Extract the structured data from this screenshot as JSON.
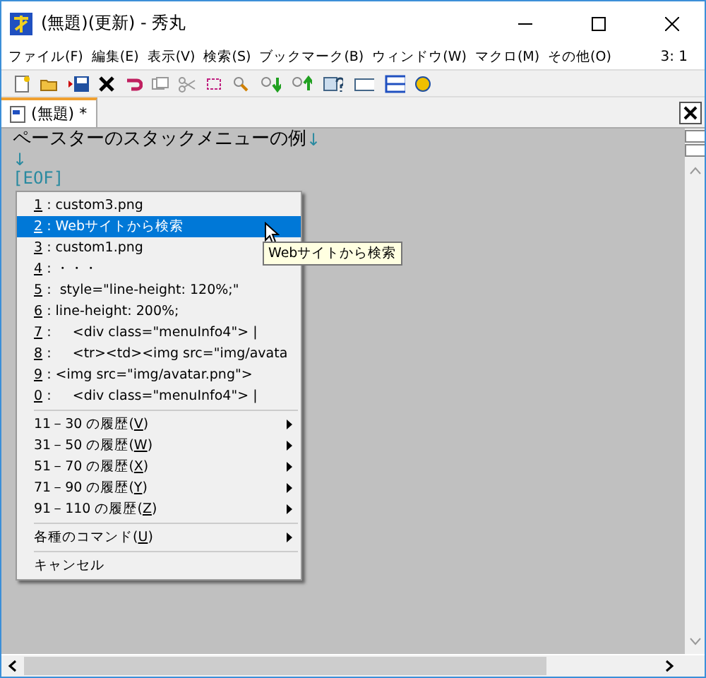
{
  "window": {
    "title": "(無題)(更新) - 秀丸"
  },
  "menu_bar": {
    "items": [
      "ファイル(F)",
      "編集(E)",
      "表示(V)",
      "検索(S)",
      "ブックマーク(B)",
      "ウィンドウ(W)",
      "マクロ(M)",
      "その他(O)"
    ],
    "position": "3: 1"
  },
  "tabs": [
    {
      "label": "(無題) *",
      "selected": true
    }
  ],
  "editor": {
    "lines": [
      {
        "text": "ペースターのスタックメニューの例",
        "newline": "↓"
      },
      {
        "newline": "↓"
      }
    ],
    "eof": "[EOF]"
  },
  "popup_menu": {
    "separator": ":",
    "history": [
      {
        "key": "1",
        "text": "custom3.png",
        "selected": false
      },
      {
        "key": "2",
        "text": "Webサイトから検索",
        "selected": true
      },
      {
        "key": "3",
        "text": "custom1.png",
        "selected": false
      },
      {
        "key": "4",
        "text": "・・・",
        "selected": false
      },
      {
        "key": "5",
        "text": " style=\"line-height: 120%;\"",
        "selected": false
      },
      {
        "key": "6",
        "text": "line-height: 200%;",
        "selected": false
      },
      {
        "key": "7",
        "text": "    <div class=\"menuInfo4\"> |",
        "selected": false
      },
      {
        "key": "8",
        "text": "    <tr><td><img src=\"img/avata",
        "selected": false
      },
      {
        "key": "9",
        "text": "<img src=\"img/avatar.png\">",
        "selected": false
      },
      {
        "key": "0",
        "text": "    <div class=\"menuInfo4\"> |",
        "selected": false
      }
    ],
    "submenus": [
      {
        "prefix": "11－30 の履歴(",
        "accel": "V",
        "suffix": ")"
      },
      {
        "prefix": "31－50 の履歴(",
        "accel": "W",
        "suffix": ")"
      },
      {
        "prefix": "51－70 の履歴(",
        "accel": "X",
        "suffix": ")"
      },
      {
        "prefix": "71－90 の履歴(",
        "accel": "Y",
        "suffix": ")"
      },
      {
        "prefix": "91－110 の履歴(",
        "accel": "Z",
        "suffix": ")"
      }
    ],
    "commands": {
      "prefix": "各種のコマンド(",
      "accel": "U",
      "suffix": ")"
    },
    "cancel": "キャンセル"
  },
  "tooltip": "Webサイトから検索"
}
